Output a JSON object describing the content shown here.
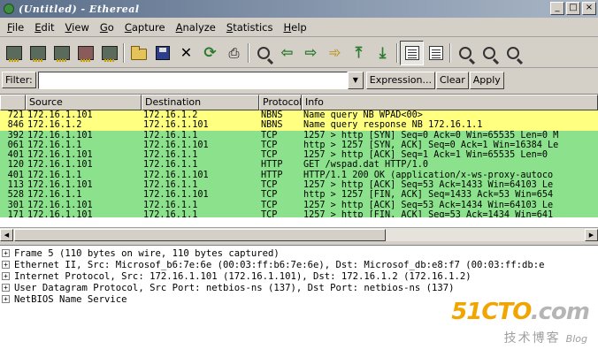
{
  "window": {
    "title": "(Untitled) - Ethereal"
  },
  "menu": [
    "File",
    "Edit",
    "View",
    "Go",
    "Capture",
    "Analyze",
    "Statistics",
    "Help"
  ],
  "menu_mnemonics": [
    "F",
    "E",
    "V",
    "G",
    "C",
    "A",
    "S",
    "H"
  ],
  "toolbar": {
    "icons": [
      "interface-list-icon",
      "capture-options-icon",
      "start-capture-icon",
      "stop-capture-icon",
      "restart-capture-icon",
      "open-file-icon",
      "save-file-icon",
      "close-file-icon",
      "reload-icon",
      "print-icon",
      "find-packet-icon",
      "go-back-icon",
      "go-forward-icon",
      "go-to-packet-icon",
      "go-first-icon",
      "go-last-icon",
      "colorize-icon",
      "auto-scroll-icon",
      "zoom-in-icon",
      "zoom-out-icon",
      "zoom-normal-icon"
    ]
  },
  "filter": {
    "label": "Filter:",
    "value": "",
    "expression_btn": "Expression...",
    "clear_btn": "Clear",
    "apply_btn": "Apply"
  },
  "packet_list": {
    "columns": [
      "",
      "Source",
      "Destination",
      "Protocol",
      "Info"
    ],
    "rows": [
      {
        "no": "721",
        "src": "172.16.1.101",
        "dst": "172.16.1.2",
        "proto": "NBNS",
        "info": "Name query NB WPAD<00>",
        "color": "yellow"
      },
      {
        "no": "846",
        "src": "172.16.1.2",
        "dst": "172.16.1.101",
        "proto": "NBNS",
        "info": "Name query response NB 172.16.1.1",
        "color": "yellow"
      },
      {
        "no": "392",
        "src": "172.16.1.101",
        "dst": "172.16.1.1",
        "proto": "TCP",
        "info": "1257 > http [SYN] Seq=0 Ack=0 Win=65535 Len=0 M",
        "color": "green"
      },
      {
        "no": "061",
        "src": "172.16.1.1",
        "dst": "172.16.1.101",
        "proto": "TCP",
        "info": "http > 1257 [SYN, ACK] Seq=0 Ack=1 Win=16384 Le",
        "color": "green"
      },
      {
        "no": "401",
        "src": "172.16.1.101",
        "dst": "172.16.1.1",
        "proto": "TCP",
        "info": "1257 > http [ACK] Seq=1 Ack=1 Win=65535 Len=0",
        "color": "green"
      },
      {
        "no": "120",
        "src": "172.16.1.101",
        "dst": "172.16.1.1",
        "proto": "HTTP",
        "info": "GET /wspad.dat HTTP/1.0",
        "color": "green"
      },
      {
        "no": "401",
        "src": "172.16.1.1",
        "dst": "172.16.1.101",
        "proto": "HTTP",
        "info": "HTTP/1.1 200 OK (application/x-ws-proxy-autoco",
        "color": "green"
      },
      {
        "no": "113",
        "src": "172.16.1.101",
        "dst": "172.16.1.1",
        "proto": "TCP",
        "info": "1257 > http [ACK] Seq=53 Ack=1433 Win=64103 Le",
        "color": "green"
      },
      {
        "no": "528",
        "src": "172.16.1.1",
        "dst": "172.16.1.101",
        "proto": "TCP",
        "info": "http > 1257 [FIN, ACK] Seq=1433 Ack=53 Win=654",
        "color": "green"
      },
      {
        "no": "301",
        "src": "172.16.1.101",
        "dst": "172.16.1.1",
        "proto": "TCP",
        "info": "1257 > http [ACK] Seq=53 Ack=1434 Win=64103 Le",
        "color": "green"
      },
      {
        "no": "171",
        "src": "172.16.1.101",
        "dst": "172.16.1.1",
        "proto": "TCP",
        "info": "1257 > http [FIN, ACK] Seq=53 Ack=1434 Win=641",
        "color": "green"
      }
    ]
  },
  "details": [
    "Frame 5 (110 bytes on wire, 110 bytes captured)",
    "Ethernet II, Src: Microsof_b6:7e:6e (00:03:ff:b6:7e:6e), Dst: Microsof_db:e8:f7 (00:03:ff:db:e",
    "Internet Protocol, Src: 172.16.1.101 (172.16.1.101), Dst: 172.16.1.2 (172.16.1.2)",
    "User Datagram Protocol, Src Port: netbios-ns (137), Dst Port: netbios-ns (137)",
    "NetBIOS Name Service"
  ],
  "details_expander": "+",
  "window_buttons": [
    "_",
    "□",
    "×"
  ],
  "watermark": {
    "logo_a": "51CTO",
    "logo_b": ".com",
    "sub": "技术博客",
    "blog": "Blog"
  },
  "colors": {
    "yellow_row": "#ffff80",
    "green_row": "#8ce28c",
    "titlebar": "#5a6e8a"
  }
}
